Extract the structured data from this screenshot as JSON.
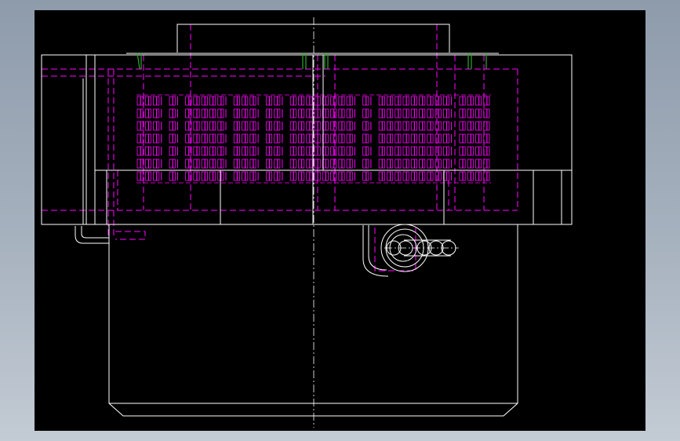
{
  "canvas": {
    "background": "#000000",
    "frame": "#9aa6b4"
  },
  "colors": {
    "outline": "#ffffff",
    "hidden": "#ff00ff",
    "grip": "#2ea82e",
    "centerline": "#ffffff"
  },
  "hatch": {
    "rows": 7,
    "fill_columns": [
      1,
      1,
      1,
      0,
      1,
      0,
      1,
      1,
      1,
      1,
      1,
      0,
      1,
      1,
      1,
      0,
      1,
      1,
      0,
      1,
      1,
      1,
      1,
      1,
      1,
      1,
      1,
      0,
      1,
      0,
      1,
      1,
      1,
      1,
      1,
      1,
      1,
      1,
      1,
      0,
      1,
      1,
      1,
      1
    ]
  }
}
